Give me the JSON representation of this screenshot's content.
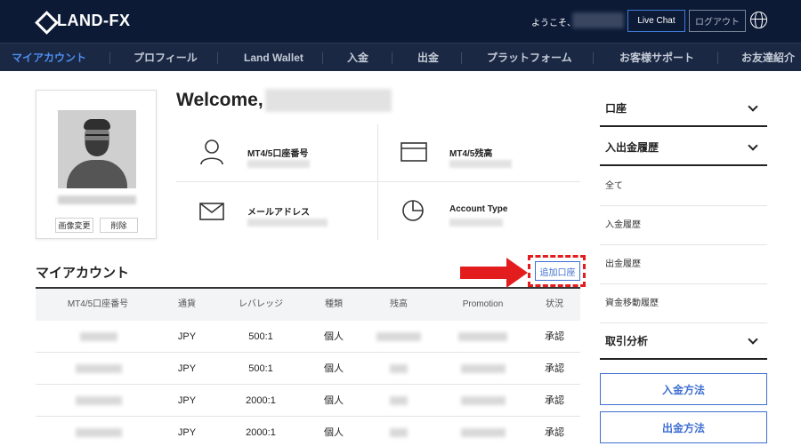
{
  "header": {
    "logo_text": "LAND-FX",
    "greeting": "ようこそ、",
    "live_chat": "Live Chat",
    "logout": "ログアウト"
  },
  "nav": {
    "items": [
      "マイアカウント",
      "プロフィール",
      "Land Wallet",
      "入金",
      "出金",
      "プラットフォーム",
      "お客様サポート",
      "お友達紹介"
    ]
  },
  "profile": {
    "change_image": "画像変更",
    "delete": "削除"
  },
  "welcome": {
    "title": "Welcome,"
  },
  "info": {
    "account_number_label": "MT4/5口座番号",
    "balance_label": "MT4/5残高",
    "email_label": "メールアドレス",
    "account_type_label": "Account Type"
  },
  "accounts": {
    "title": "マイアカウント",
    "add_button": "追加口座",
    "columns": [
      "MT4/5口座番号",
      "通貨",
      "レバレッジ",
      "種類",
      "残高",
      "Promotion",
      "状況"
    ],
    "rows": [
      {
        "currency": "JPY",
        "leverage": "500:1",
        "type": "個人",
        "status": "承認"
      },
      {
        "currency": "JPY",
        "leverage": "500:1",
        "type": "個人",
        "status": "承認"
      },
      {
        "currency": "JPY",
        "leverage": "2000:1",
        "type": "個人",
        "status": "承認"
      },
      {
        "currency": "JPY",
        "leverage": "2000:1",
        "type": "個人",
        "status": "承認"
      }
    ]
  },
  "sidebar": {
    "sections": [
      "口座",
      "入出金履歴",
      "取引分析"
    ],
    "history_items": [
      "全て",
      "入金履歴",
      "出金履歴",
      "資金移動履歴"
    ],
    "deposit_method": "入金方法",
    "withdraw_method": "出金方法"
  },
  "colors": {
    "header_bg": "#0c1a36",
    "nav_bg": "#1a2844",
    "accent": "#3f6fd1",
    "highlight": "#e31d1d"
  }
}
